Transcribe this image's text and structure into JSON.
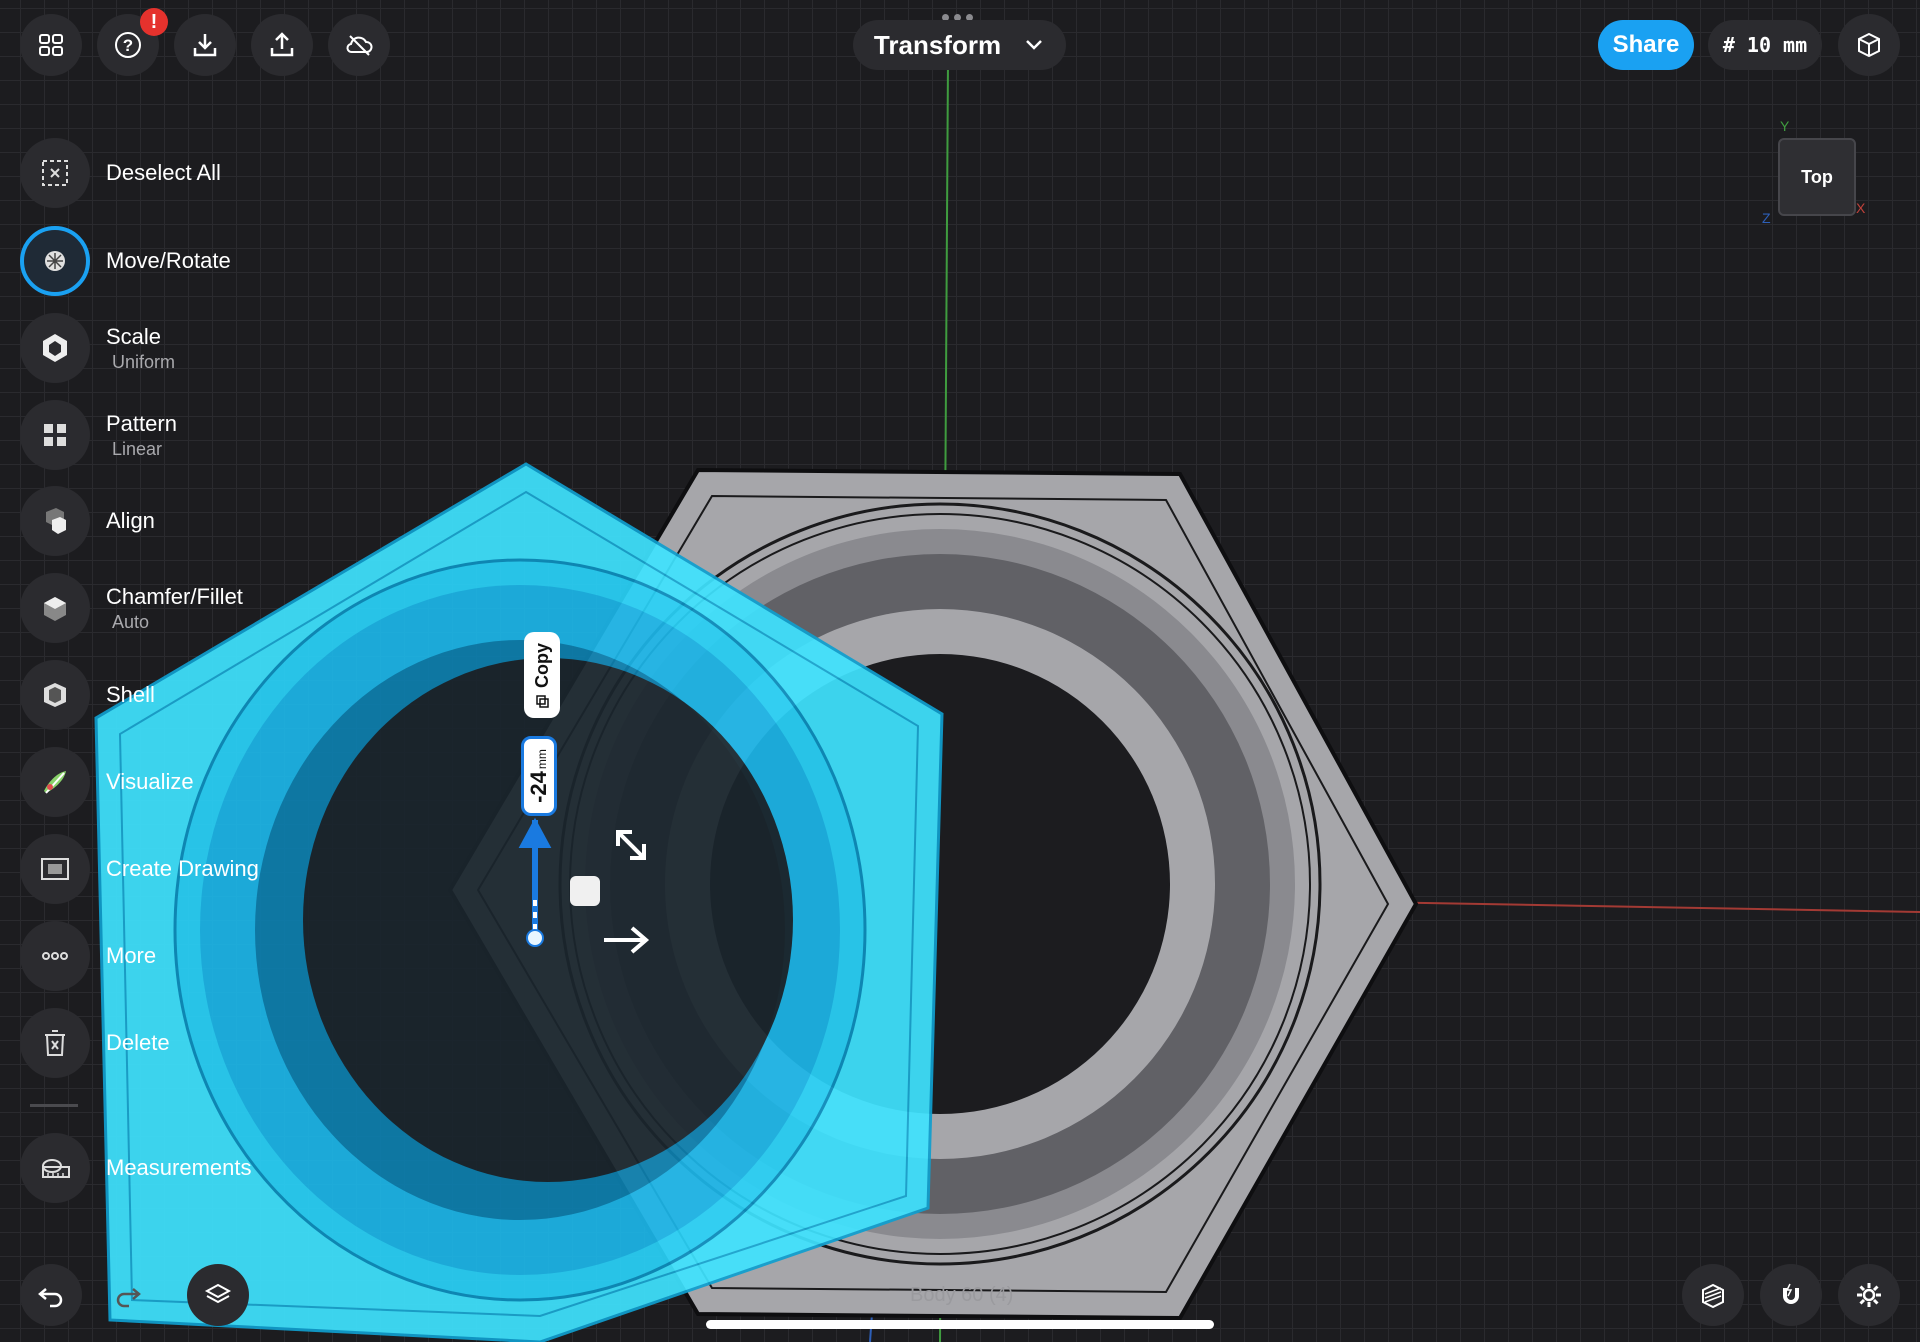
{
  "toolbar": {
    "left_buttons": [
      "grid-icon",
      "help-icon",
      "import-icon",
      "export-icon",
      "cloud-off-icon"
    ],
    "badge": "!",
    "title": "Transform",
    "share_label": "Share",
    "grid_size": "# 10 mm",
    "right_icon": "view-mode-icon"
  },
  "menu": {
    "items": [
      {
        "label": "Deselect All",
        "sub": ""
      },
      {
        "label": "Move/Rotate",
        "sub": ""
      },
      {
        "label": "Scale",
        "sub": "Uniform"
      },
      {
        "label": "Pattern",
        "sub": "Linear"
      },
      {
        "label": "Align",
        "sub": ""
      },
      {
        "label": "Chamfer/Fillet",
        "sub": "Auto"
      },
      {
        "label": "Shell",
        "sub": ""
      },
      {
        "label": "Visualize",
        "sub": ""
      },
      {
        "label": "Create Drawing",
        "sub": ""
      },
      {
        "label": "More",
        "sub": ""
      },
      {
        "label": "Delete",
        "sub": ""
      },
      {
        "label": "Measurements",
        "sub": ""
      }
    ]
  },
  "viewcube": {
    "face": "Top",
    "x_axis": "X",
    "y_axis": "Y",
    "z_axis": "Z"
  },
  "gizmo": {
    "copy_label": "Copy",
    "distance_value": "-24",
    "distance_unit": "mm"
  },
  "bottom": {
    "body_label": "Body 60 (4)"
  },
  "colors": {
    "accent": "#1aa1f2",
    "selection": "#33dcff",
    "model": "#a6a6aa"
  }
}
